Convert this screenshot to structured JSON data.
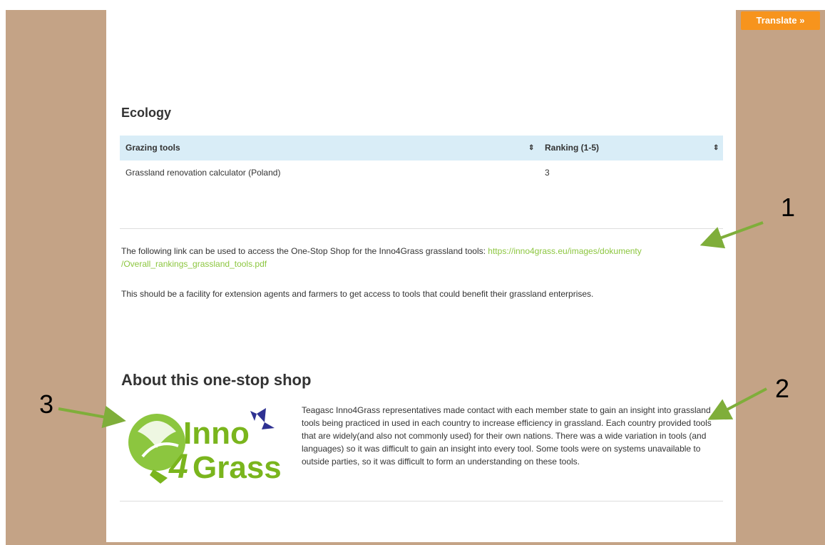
{
  "translate": {
    "label": "Translate »"
  },
  "ecology": {
    "heading": "Ecology",
    "table": {
      "columns": [
        "Grazing tools",
        "Ranking (1-5)"
      ],
      "sort_icon": "⇕",
      "rows": [
        {
          "tool": "Grassland renovation calculator (Poland)",
          "rank": "3"
        }
      ]
    }
  },
  "link_paragraph": {
    "text": "The following link can be used to access the One-Stop Shop for the Inno4Grass grassland tools: ",
    "link_line1": "https://inno4grass.eu/images/dokumenty",
    "link_line2": "/Overall_rankings_grassland_tools.pdf"
  },
  "facility_paragraph": "This should be a facility for extension agents and farmers to get access to tools that could benefit their grassland enterprises.",
  "about": {
    "heading": "About this one-stop shop",
    "body": "Teagasc Inno4Grass representatives made contact with each member state to gain an insight into grassland tools being practiced in used in each country to increase efficiency in grassland. Each country provided tools that are widely(and also not commonly used) for their own nations. There was a wide variation in tools (and languages) so it was difficult to gain an insight into every tool. Some tools were on systems unavailable to outside parties, so it was difficult to form an understanding on these tools.",
    "logo_text": {
      "top": "Inno",
      "digit": "4",
      "bottom": "Grass"
    }
  },
  "callouts": [
    "1",
    "2",
    "3"
  ],
  "colors": {
    "background": "#c4a386",
    "accent_green": "#8cc63f",
    "logo_green": "#7ab51d",
    "butterfly": "#2e3192",
    "arrow": "#7fae3a",
    "translate_orange": "#f7941d",
    "table_header": "#d9edf7"
  }
}
